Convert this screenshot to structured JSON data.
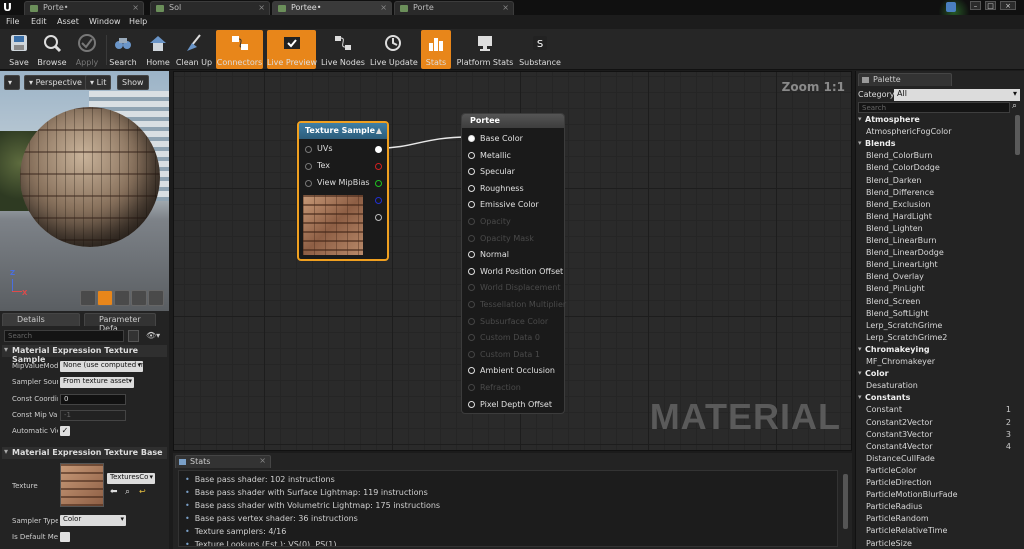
{
  "tabs": [
    "Porte•",
    "Sol",
    "Portee•",
    "Porte"
  ],
  "menu": [
    "File",
    "Edit",
    "Asset",
    "Window",
    "Help"
  ],
  "toolbar": [
    {
      "label": "Save",
      "icon": "save-icon"
    },
    {
      "label": "Browse",
      "icon": "browse-icon"
    },
    {
      "label": "Apply",
      "icon": "apply-icon"
    },
    {
      "label": "Search",
      "icon": "search-icon"
    },
    {
      "label": "Home",
      "icon": "home-icon"
    },
    {
      "label": "Clean Up",
      "icon": "broom-icon"
    },
    {
      "label": "Connectors",
      "icon": "connectors-icon"
    },
    {
      "label": "Live Preview",
      "icon": "live-preview-icon"
    },
    {
      "label": "Live Nodes",
      "icon": "live-nodes-icon"
    },
    {
      "label": "Live Update",
      "icon": "live-update-icon"
    },
    {
      "label": "Stats",
      "icon": "stats-icon"
    },
    {
      "label": "Platform Stats",
      "icon": "platform-stats-icon"
    },
    {
      "label": "Substance",
      "icon": "substance-icon"
    }
  ],
  "viewport": {
    "perspective": "Perspective",
    "lit": "Lit",
    "show": "Show",
    "axis_x": "X",
    "axis_z": "Z"
  },
  "details": {
    "tab_details": "Details",
    "tab_params": "Parameter Defa",
    "search_placeholder": "Search",
    "section1": "Material Expression Texture Sample",
    "mip_label": "MipValueMod",
    "mip_value": "None (use computed m",
    "sampler_source_label": "Sampler Sour",
    "sampler_source_value": "From texture asset",
    "const_coord_label": "Const Coordir",
    "const_coord_value": "0",
    "const_mip_label": "Const Mip Val",
    "const_mip_value": "-1",
    "auto_view_label": "Automatic Vie",
    "section2": "Material Expression Texture Base",
    "texture_label": "Texture",
    "texture_value": "TexturesCo",
    "sampler_type_label": "Sampler Type",
    "sampler_type_value": "Color",
    "is_default_label": "Is Default Me"
  },
  "graph": {
    "zoom": "Zoom 1:1",
    "watermark": "MATERIAL"
  },
  "texture_node": {
    "title": "Texture Sample",
    "inputs": [
      "UVs",
      "Tex",
      "View MipBias"
    ]
  },
  "material_node": {
    "title": "Portee",
    "pins": [
      {
        "label": "Base Color",
        "enabled": true,
        "linked": true
      },
      {
        "label": "Metallic",
        "enabled": true
      },
      {
        "label": "Specular",
        "enabled": true
      },
      {
        "label": "Roughness",
        "enabled": true
      },
      {
        "label": "Emissive Color",
        "enabled": true
      },
      {
        "label": "Opacity",
        "enabled": false
      },
      {
        "label": "Opacity Mask",
        "enabled": false
      },
      {
        "label": "Normal",
        "enabled": true
      },
      {
        "label": "World Position Offset",
        "enabled": true
      },
      {
        "label": "World Displacement",
        "enabled": false
      },
      {
        "label": "Tessellation Multiplier",
        "enabled": false
      },
      {
        "label": "Subsurface Color",
        "enabled": false
      },
      {
        "label": "Custom Data 0",
        "enabled": false
      },
      {
        "label": "Custom Data 1",
        "enabled": false
      },
      {
        "label": "Ambient Occlusion",
        "enabled": true
      },
      {
        "label": "Refraction",
        "enabled": false
      },
      {
        "label": "Pixel Depth Offset",
        "enabled": true
      }
    ]
  },
  "stats": {
    "tab": "Stats",
    "lines": [
      "Base pass shader: 102 instructions",
      "Base pass shader with Surface Lightmap: 119 instructions",
      "Base pass shader with Volumetric Lightmap: 175 instructions",
      "Base pass vertex shader: 36 instructions",
      "Texture samplers: 4/16",
      "Texture Lookups (Est.): VS(0), PS(1)"
    ]
  },
  "palette": {
    "tab": "Palette",
    "category_label": "Category:",
    "category_value": "All",
    "search_placeholder": "Search",
    "rows": [
      {
        "type": "cat",
        "label": "Atmosphere"
      },
      {
        "type": "item",
        "label": "AtmosphericFogColor"
      },
      {
        "type": "cat",
        "label": "Blends"
      },
      {
        "type": "item",
        "label": "Blend_ColorBurn"
      },
      {
        "type": "item",
        "label": "Blend_ColorDodge"
      },
      {
        "type": "item",
        "label": "Blend_Darken"
      },
      {
        "type": "item",
        "label": "Blend_Difference"
      },
      {
        "type": "item",
        "label": "Blend_Exclusion"
      },
      {
        "type": "item",
        "label": "Blend_HardLight"
      },
      {
        "type": "item",
        "label": "Blend_Lighten"
      },
      {
        "type": "item",
        "label": "Blend_LinearBurn"
      },
      {
        "type": "item",
        "label": "Blend_LinearDodge"
      },
      {
        "type": "item",
        "label": "Blend_LinearLight"
      },
      {
        "type": "item",
        "label": "Blend_Overlay"
      },
      {
        "type": "item",
        "label": "Blend_PinLight"
      },
      {
        "type": "item",
        "label": "Blend_Screen"
      },
      {
        "type": "item",
        "label": "Blend_SoftLight"
      },
      {
        "type": "item",
        "label": "Lerp_ScratchGrime"
      },
      {
        "type": "item",
        "label": "Lerp_ScratchGrime2"
      },
      {
        "type": "cat",
        "label": "Chromakeying"
      },
      {
        "type": "item",
        "label": "MF_Chromakeyer"
      },
      {
        "type": "cat",
        "label": "Color"
      },
      {
        "type": "item",
        "label": "Desaturation"
      },
      {
        "type": "cat",
        "label": "Constants"
      },
      {
        "type": "item",
        "label": "Constant",
        "key": "1"
      },
      {
        "type": "item",
        "label": "Constant2Vector",
        "key": "2"
      },
      {
        "type": "item",
        "label": "Constant3Vector",
        "key": "3"
      },
      {
        "type": "item",
        "label": "Constant4Vector",
        "key": "4"
      },
      {
        "type": "item",
        "label": "DistanceCullFade"
      },
      {
        "type": "item",
        "label": "ParticleColor"
      },
      {
        "type": "item",
        "label": "ParticleDirection"
      },
      {
        "type": "item",
        "label": "ParticleMotionBlurFade"
      },
      {
        "type": "item",
        "label": "ParticleRadius"
      },
      {
        "type": "item",
        "label": "ParticleRandom"
      },
      {
        "type": "item",
        "label": "ParticleRelativeTime"
      },
      {
        "type": "item",
        "label": "ParticleSize"
      }
    ]
  },
  "colors": {
    "accent": "#e8861a",
    "selection": "#f0a020",
    "header_blue": "#3f7fa6"
  }
}
